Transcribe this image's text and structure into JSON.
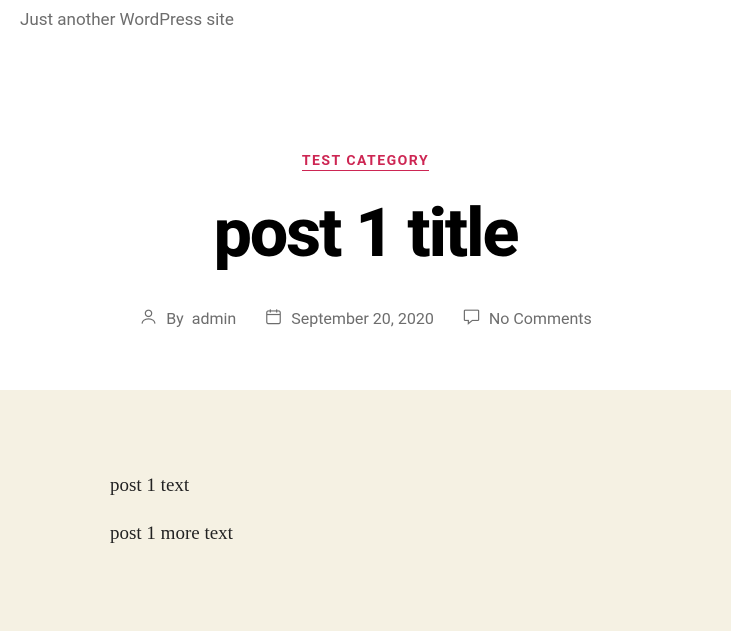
{
  "site": {
    "tagline": "Just another WordPress site"
  },
  "post": {
    "category": "TEST CATEGORY",
    "title": "post 1 title",
    "meta": {
      "by_label": "By",
      "author": "admin",
      "date": "September 20, 2020",
      "comments": "No Comments"
    },
    "content": {
      "para1": "post 1 text",
      "para2": "post 1 more text"
    }
  }
}
